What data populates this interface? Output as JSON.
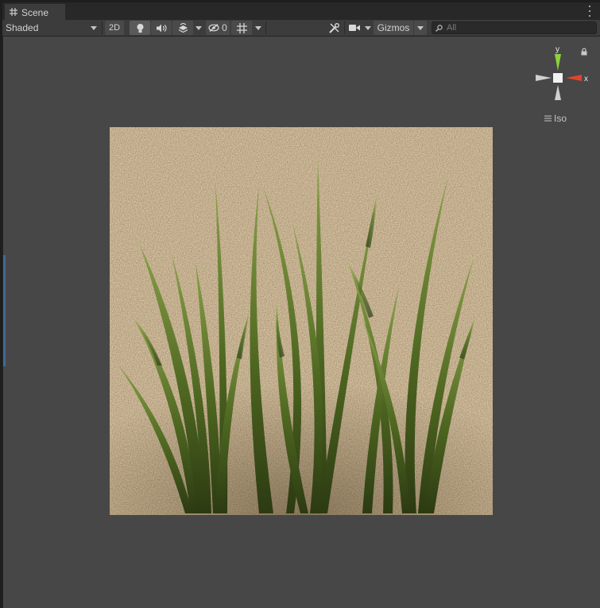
{
  "tab": {
    "label": "Scene",
    "icon": "grid-icon"
  },
  "toolbar": {
    "shading_mode": "Shaded",
    "mode_2d_label": "2D",
    "hidden_count": "0",
    "gizmos_label": "Gizmos",
    "search_placeholder": "All"
  },
  "gizmo": {
    "y_label": "y",
    "x_label": "x",
    "projection_label": "Iso"
  },
  "colors": {
    "axis_y": "#8fd13a",
    "axis_x": "#e0442c",
    "viewport_bg": "#474747",
    "toolbar_bg": "#3c3c3c"
  }
}
